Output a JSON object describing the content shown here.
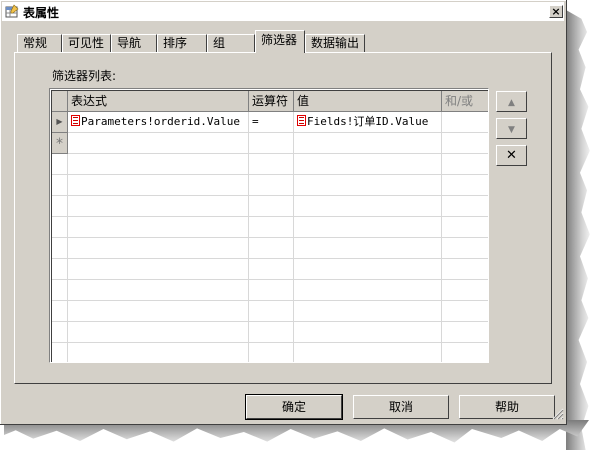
{
  "window": {
    "title": "表属性",
    "close_glyph": "×"
  },
  "tabs": [
    {
      "label": "常规",
      "active": false
    },
    {
      "label": "可见性",
      "active": false
    },
    {
      "label": "导航",
      "active": false
    },
    {
      "label": "排序",
      "active": false
    },
    {
      "label": "组",
      "active": false
    },
    {
      "label": "筛选器",
      "active": true
    },
    {
      "label": "数据输出",
      "active": false
    }
  ],
  "filter_panel": {
    "list_label": "筛选器列表:",
    "columns": [
      "表达式",
      "运算符",
      "值",
      "和/或"
    ],
    "rows": [
      {
        "expression": "Parameters!orderid.Value",
        "operator": "=",
        "value": "Fields!订单ID.Value",
        "and_or": ""
      }
    ],
    "new_row_marker": "*",
    "current_row_marker": "▶"
  },
  "side_buttons": {
    "move_up_glyph": "▲",
    "move_down_glyph": "▼",
    "delete_glyph": "✕"
  },
  "footer": {
    "ok_label": "确定",
    "cancel_label": "取消",
    "help_label": "帮助"
  },
  "colors": {
    "dialog_bg": "#d4d0c8",
    "expression_icon_border": "#e00000"
  }
}
